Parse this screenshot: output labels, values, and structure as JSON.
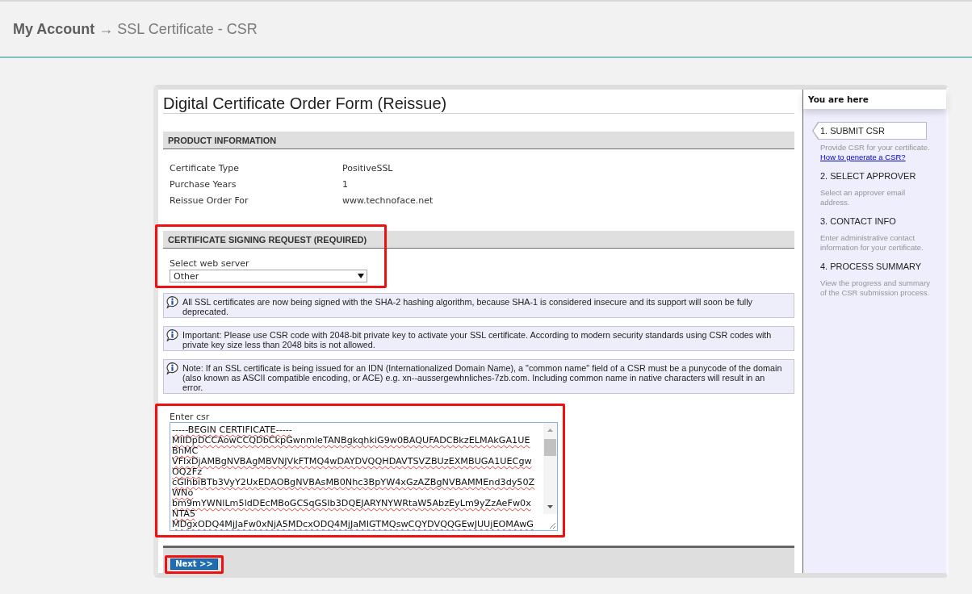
{
  "breadcrumb": [
    {
      "kind": "link",
      "label": "My Account"
    },
    {
      "kind": "separator",
      "label": "→"
    },
    {
      "kind": "current",
      "label": "SSL Certificate - CSR"
    }
  ],
  "form": {
    "title": "Digital Certificate Order Form (Reissue)",
    "product_information": {
      "heading": "PRODUCT INFORMATION",
      "rows": [
        {
          "label": "Certificate Type",
          "value": "PositiveSSL"
        },
        {
          "label": "Purchase Years",
          "value": "1"
        },
        {
          "label": "Reissue Order For",
          "value": "www.technoface.net"
        }
      ]
    },
    "csr_request": {
      "heading": "CERTIFICATE SIGNING REQUEST (REQUIRED)",
      "highlighted": true,
      "web_server": {
        "label": "Select web server",
        "value": "Other"
      }
    },
    "notices": [
      {
        "text": "All SSL certificates are now being signed with the SHA-2 hashing algorithm, because SHA-1 is considered insecure and its support will soon be fully deprecated."
      },
      {
        "text": "Important: Please use CSR code with 2048-bit private key to activate your SSL certificate. According to modern security standards using CSR codes with private key size less than 2048 bits is not allowed."
      },
      {
        "text": "Note: If an SSL certificate is being issued for an IDN (Internationalized Domain Name), a \"common name\" field of a CSR must be a punycode of the domain (also known as ASCII compatible encoding, or ACE) e.g. xn--aussergewhnliches-7zb.com. Including common name in native characters will result in an error."
      }
    ],
    "csr_input": {
      "label": "Enter csr",
      "highlighted": true,
      "lines": [
        "-----BEGIN CERTIFICATE-----",
        "MIIDpDCCAowCCQDbCkpGwnmleTANBgkqhkiG9w0BAQUFADCBkzELMAkGA1UE",
        "BhMC",
        "VFIxDjAMBgNVBAgMBVNJVkFTMQ4wDAYDVQQHDAVTSVZBUzEXMBUGA1UECgw",
        "OQ2Fz",
        "cGlhbiBTb3VyY2UxEDAOBgNVBAsMB0Nhc3BpYW4xGzAZBgNVBAMMEnd3dy50Z",
        "WNo",
        "bm9mYWNlLm5ldDEcMBoGCSqGSIb3DQEJARYNYWRtaW5AbzEyLm9yZzAeFw0x",
        "NTA5",
        "MDgxODQ4MjJaFw0xNjA5MDcxODQ4MjJaMIGTMQswCQYDVQQGEwJUUjEOMAwG"
      ]
    },
    "next_button": {
      "label": "Next >>",
      "highlighted": true
    }
  },
  "sidebar": {
    "heading": "You are here",
    "steps": [
      {
        "title": "1. SUBMIT CSR",
        "selected": true,
        "description": "Provide CSR for your certificate.",
        "link": "How to generate a CSR?"
      },
      {
        "title": "2. SELECT APPROVER",
        "selected": false,
        "description": "Select an approver email\naddress."
      },
      {
        "title": "3. CONTACT INFO",
        "selected": false,
        "description": "Enter administrative contact\ninformation for your certificate."
      },
      {
        "title": "4. PROCESS SUMMARY",
        "selected": false,
        "description": "View the progress and summary\nof the CSR submission process."
      }
    ]
  }
}
